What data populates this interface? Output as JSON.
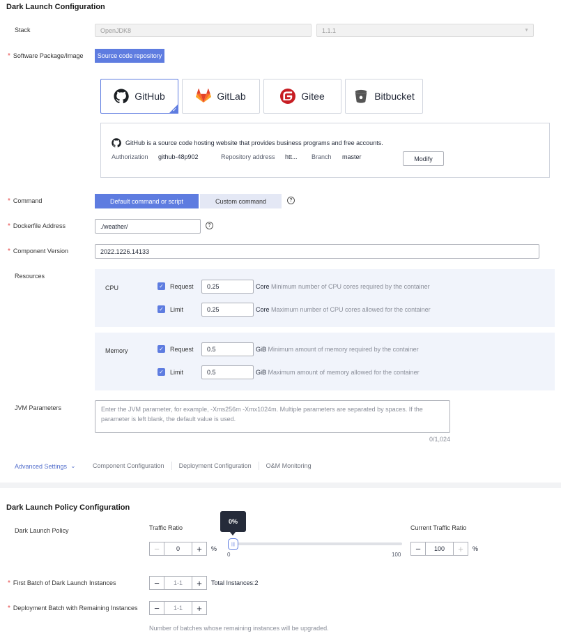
{
  "section1": {
    "title": "Dark Launch Configuration"
  },
  "stack": {
    "label": "Stack",
    "runtime": "OpenJDK8",
    "version": "1.1.1"
  },
  "software": {
    "label": "Software Package/Image",
    "source_button": "Source code repository"
  },
  "repos": [
    {
      "name": "GitHub",
      "icon": "github-icon"
    },
    {
      "name": "GitLab",
      "icon": "gitlab-icon"
    },
    {
      "name": "Gitee",
      "icon": "gitee-icon"
    },
    {
      "name": "Bitbucket",
      "icon": "bitbucket-icon"
    }
  ],
  "repo_info": {
    "description": "GitHub is a source code hosting website that provides business programs and free accounts.",
    "auth_label": "Authorization",
    "auth_value": "github-48p902",
    "repo_label": "Repository address",
    "repo_value": "htt...",
    "branch_label": "Branch",
    "branch_value": "master",
    "modify_button": "Modify"
  },
  "command": {
    "label": "Command",
    "default_button": "Default command or script",
    "custom_button": "Custom command"
  },
  "dockerfile": {
    "label": "Dockerfile Address",
    "value": "./weather/"
  },
  "component_version": {
    "label": "Component Version",
    "value": "2022.1226.14133"
  },
  "resources": {
    "label": "Resources",
    "cpu": {
      "label": "CPU",
      "request_label": "Request",
      "request_value": "0.25",
      "request_unit": "Core",
      "request_desc": "Minimum number of CPU cores required by the container",
      "limit_label": "Limit",
      "limit_value": "0.25",
      "limit_unit": "Core",
      "limit_desc": "Maximum number of CPU cores allowed for the container"
    },
    "memory": {
      "label": "Memory",
      "request_label": "Request",
      "request_value": "0.5",
      "request_unit": "GiB",
      "request_desc": "Minimum amount of memory required by the container",
      "limit_label": "Limit",
      "limit_value": "0.5",
      "limit_unit": "GiB",
      "limit_desc": "Maximum amount of memory allowed for the container"
    }
  },
  "jvm": {
    "label": "JVM Parameters",
    "placeholder": "Enter the JVM parameter, for example, -Xms256m -Xmx1024m. Multiple parameters are separated by spaces. If the parameter is left blank, the default value is used.",
    "counter": "0/1,024"
  },
  "advanced": {
    "label": "Advanced Settings",
    "tabs": [
      "Component Configuration",
      "Deployment Configuration",
      "O&M Monitoring"
    ]
  },
  "section2": {
    "title": "Dark Launch Policy Configuration"
  },
  "policy": {
    "label": "Dark Launch Policy",
    "traffic_ratio_label": "Traffic Ratio",
    "traffic_ratio_value": "0",
    "percent": "%",
    "slider_tooltip": "0%",
    "slider_min": "0",
    "slider_max": "100",
    "slider_level": 0,
    "current_label": "Current Traffic Ratio",
    "current_value": "100"
  },
  "first_batch": {
    "label": "First Batch of Dark Launch Instances",
    "value": "1-1",
    "total": "Total Instances:2"
  },
  "remaining_batch": {
    "label": "Deployment Batch with Remaining Instances",
    "value": "1-1",
    "hint": "Number of batches whose remaining instances will be upgraded."
  },
  "colors": {
    "primary": "#5e7ce0",
    "required": "#e54545",
    "panel": "#f1f4fb"
  }
}
